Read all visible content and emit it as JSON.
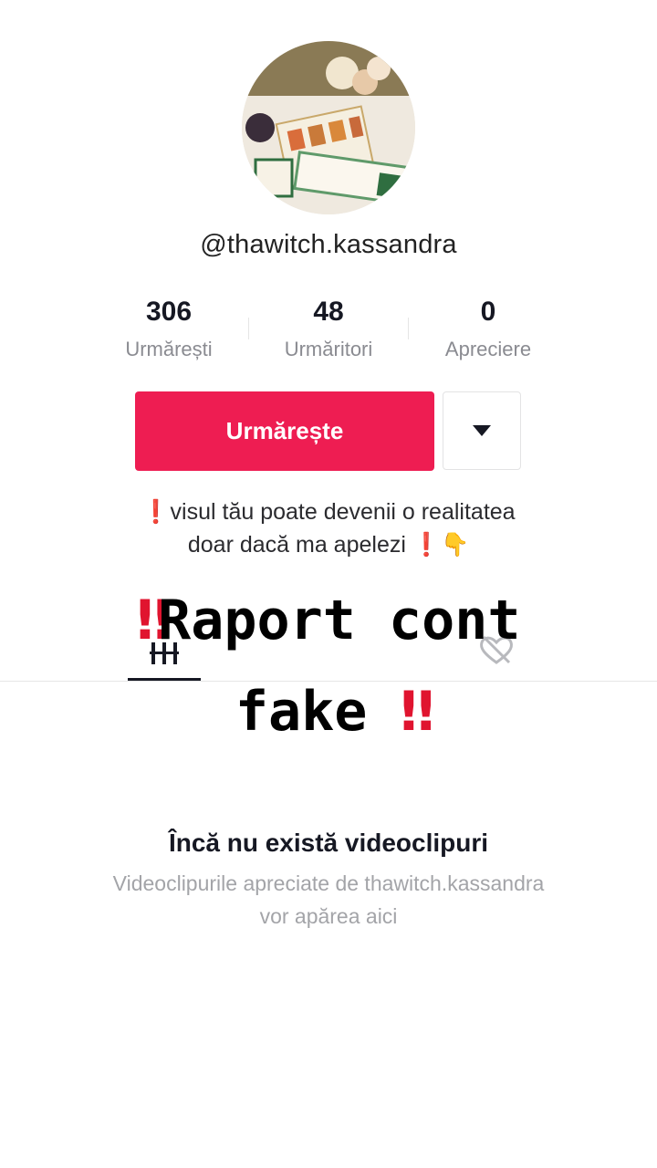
{
  "profile": {
    "username": "@thawitch.kassandra",
    "avatar_alt": "tarot-cards-avatar"
  },
  "stats": [
    {
      "value": "306",
      "label": "Urmărești"
    },
    {
      "value": "48",
      "label": "Urmăritori"
    },
    {
      "value": "0",
      "label": "Apreciere"
    }
  ],
  "actions": {
    "follow_label": "Urmărește",
    "dropdown_icon": "caret-down-icon"
  },
  "bio": {
    "line1": "visul tău poate devenii o realitatea",
    "line2": "doar dacă ma apelezi",
    "emoji_point": "👇"
  },
  "tabs": {
    "videos_icon": "grid-icon",
    "liked_icon": "liked-private-icon"
  },
  "overlay": {
    "line1": "Raport cont",
    "line2": "fake",
    "bang": "‼"
  },
  "empty_state": {
    "title": "Încă nu există videoclipuri",
    "subtitle_line1": "Videoclipurile apreciate de thawitch.kassandra",
    "subtitle_line2": "vor apărea aici"
  },
  "colors": {
    "accent": "#ee1d52",
    "alert": "#e0142f"
  }
}
